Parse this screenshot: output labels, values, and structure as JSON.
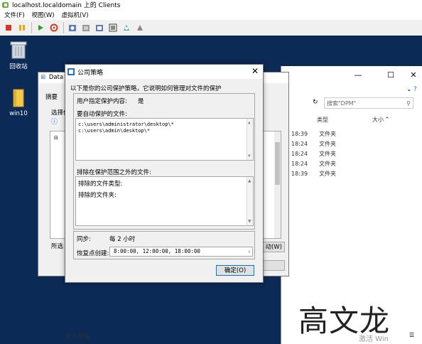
{
  "window": {
    "title": "localhost.localdomain 上的 Clients"
  },
  "menu": {
    "items": [
      "文件(F)",
      "视图(W)",
      "虚拟机(V)"
    ]
  },
  "desktop": {
    "icons": [
      {
        "label": "回收站",
        "icon": "recycle-bin-icon"
      },
      {
        "label": "win10",
        "icon": "folder-icon"
      }
    ]
  },
  "data_window": {
    "title": "Data",
    "tab": "摘要",
    "select_label": "选择保",
    "footer_label": "所选"
  },
  "explorer": {
    "search_placeholder": "搜索\"DPM\"",
    "columns": [
      "类型",
      "大小"
    ],
    "rows": [
      {
        "time": "18:39",
        "type": "文件夹"
      },
      {
        "time": "18:24",
        "type": "文件夹"
      },
      {
        "time": "18:24",
        "type": "文件夹"
      },
      {
        "time": "18:24",
        "type": "文件夹"
      },
      {
        "time": "18:39",
        "type": "文件夹"
      }
    ],
    "status": "5 个项目",
    "behind_button": "动(W)"
  },
  "dialog": {
    "title": "公司策略",
    "description": "以下是你的公司保护策略，它说明如何管理对文件的保护",
    "user_specified_label": "用户指定保护内容:",
    "user_specified_value": "是",
    "auto_protect_label": "要自动保护的文件:",
    "auto_protect_files": [
      "c:\\users\\administrator\\desktop\\*",
      "c:\\users\\admin\\desktop\\*"
    ],
    "excluded_label": "排除在保护范围之外的文件:",
    "excluded_types_label": "排除的文件类型:",
    "excluded_folders_label": "排除的文件夹:",
    "sync_label": "同步:",
    "sync_value": "每 2 小时",
    "restore_label": "恢复点创建:",
    "restore_value": "8:00:00,  12:00:00,  18:00:00",
    "ok_label": "确定(O)"
  },
  "watermark": {
    "text": "高文龙",
    "activate": "激活 Win"
  },
  "colors": {
    "desktop_bg": "#0b2a55",
    "accent": "#0078d7"
  }
}
